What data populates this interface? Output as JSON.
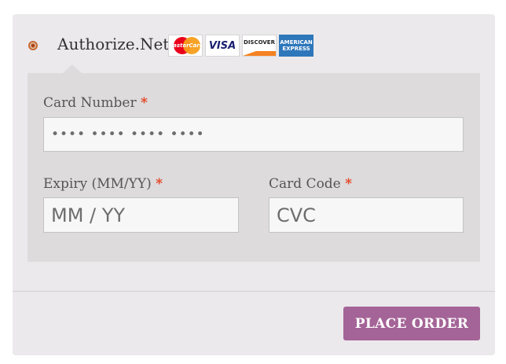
{
  "payment_method": {
    "label": "Authorize.Net",
    "selected": true,
    "card_logos": [
      {
        "name": "mastercard",
        "text": "MasterCard"
      },
      {
        "name": "visa",
        "text": "VISA"
      },
      {
        "name": "discover",
        "text": "DISCOVER"
      },
      {
        "name": "american-express",
        "text": "AMERICAN EXPRESS"
      }
    ]
  },
  "form": {
    "card_number": {
      "label": "Card Number",
      "required_mark": "*",
      "placeholder": "•••• •••• •••• ••••"
    },
    "expiry": {
      "label": "Expiry (MM/YY)",
      "required_mark": "*",
      "placeholder": "MM / YY"
    },
    "card_code": {
      "label": "Card Code",
      "required_mark": "*",
      "placeholder": "CVC"
    }
  },
  "actions": {
    "place_order_label": "PLACE ORDER"
  },
  "colors": {
    "accent": "#a46497",
    "required": "#e2401c",
    "panel": "#ebe9eb",
    "form_box": "#dddbdc"
  }
}
